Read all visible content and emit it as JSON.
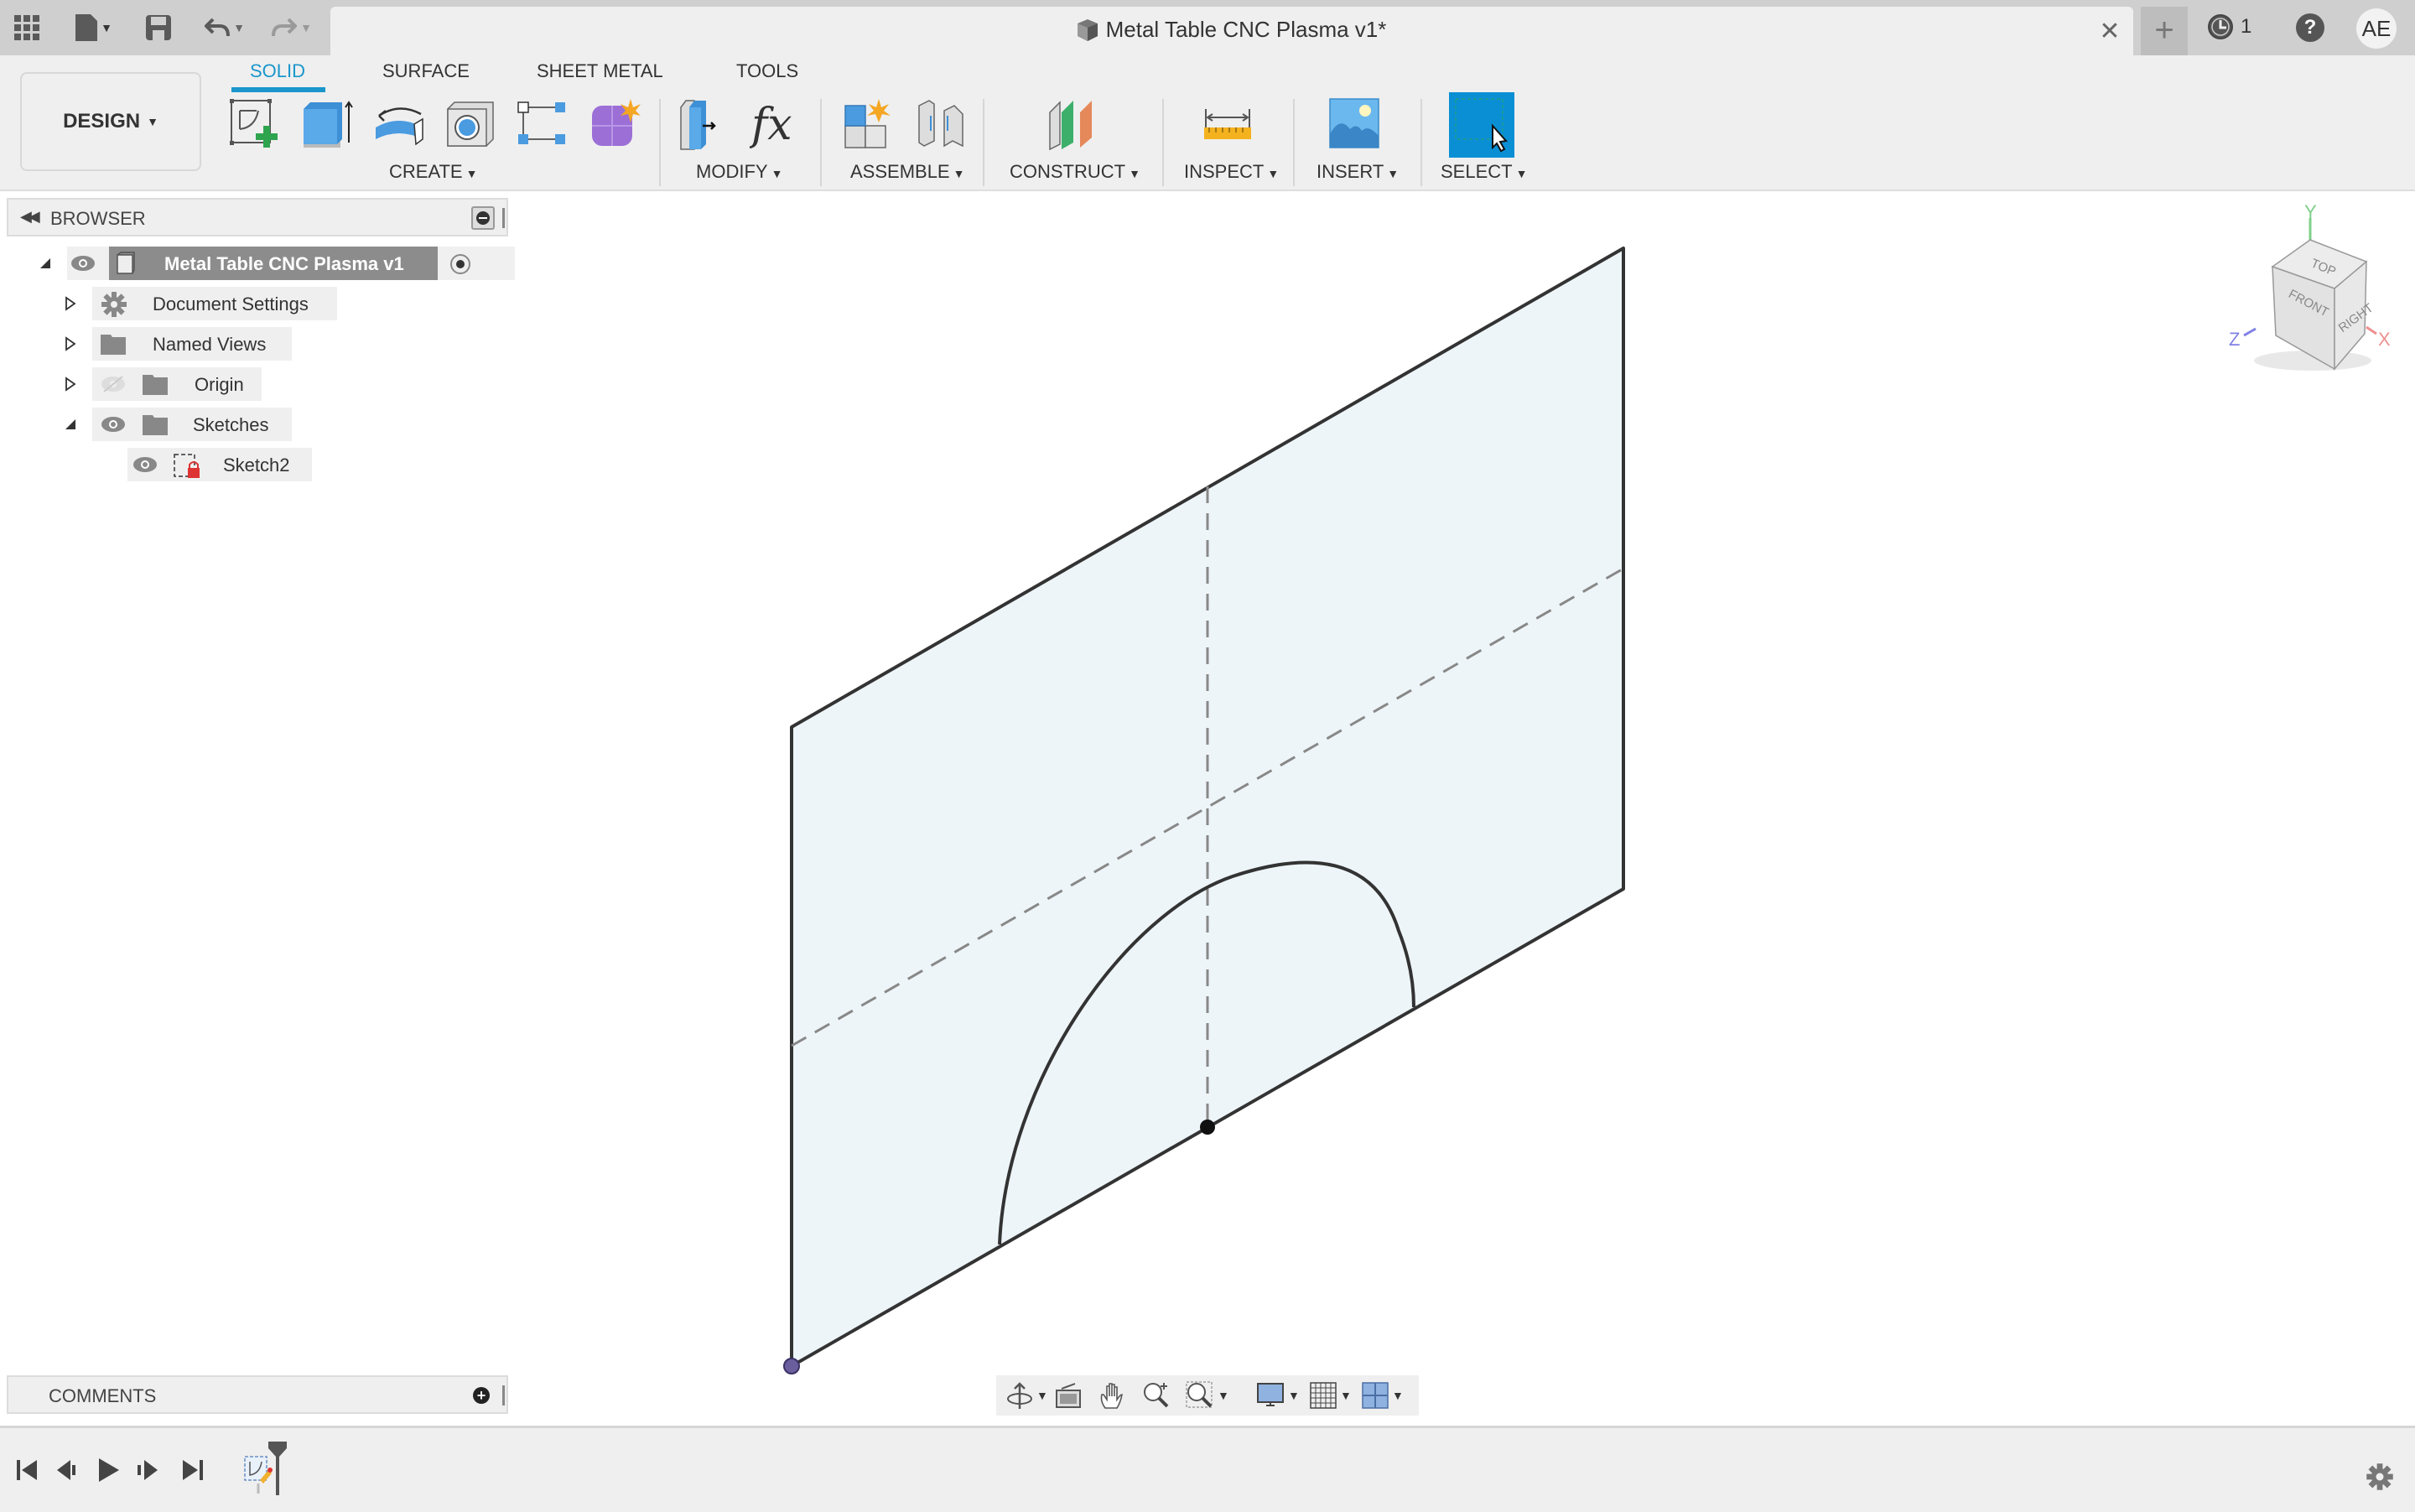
{
  "app": {
    "document_title": "Metal Table CNC Plasma v1*",
    "jobs_count": "1",
    "user_initials": "AE"
  },
  "topbar": {
    "icons": [
      "apps-grid-icon",
      "file-icon",
      "save-icon",
      "undo-icon",
      "redo-icon"
    ]
  },
  "workspace": {
    "label": "DESIGN"
  },
  "ribbon": {
    "tabs": [
      {
        "label": "SOLID",
        "active": true
      },
      {
        "label": "SURFACE",
        "active": false
      },
      {
        "label": "SHEET METAL",
        "active": false
      },
      {
        "label": "TOOLS",
        "active": false
      }
    ],
    "groups": [
      {
        "label": "CREATE",
        "tools": [
          "create-sketch",
          "extrude",
          "revolve",
          "hole",
          "pattern",
          "create-form"
        ]
      },
      {
        "label": "MODIFY",
        "tools": [
          "press-pull",
          "parameters"
        ]
      },
      {
        "label": "ASSEMBLE",
        "tools": [
          "new-component",
          "joint"
        ]
      },
      {
        "label": "CONSTRUCT",
        "tools": [
          "offset-plane"
        ]
      },
      {
        "label": "INSPECT",
        "tools": [
          "measure"
        ]
      },
      {
        "label": "INSERT",
        "tools": [
          "insert-image"
        ]
      },
      {
        "label": "SELECT",
        "tools": [
          "select"
        ]
      }
    ],
    "accent_color": "#1a96cc"
  },
  "browser": {
    "title": "BROWSER",
    "items": [
      {
        "label": "Metal Table CNC Plasma v1",
        "expanded": true,
        "visible": true,
        "selected": true
      },
      {
        "label": "Document Settings",
        "expanded": false
      },
      {
        "label": "Named Views",
        "expanded": false
      },
      {
        "label": "Origin",
        "expanded": false,
        "visible": false
      },
      {
        "label": "Sketches",
        "expanded": true,
        "visible": true
      },
      {
        "label": "Sketch2",
        "visible": true
      }
    ]
  },
  "comments": {
    "title": "COMMENTS"
  },
  "viewcube": {
    "faces": {
      "top": "TOP",
      "front": "FRONT",
      "right": "RIGHT"
    },
    "axes": {
      "x": "X",
      "y": "Y",
      "z": "Z"
    }
  },
  "navbar": {
    "icons": [
      "orbit-icon",
      "look-at-icon",
      "pan-icon",
      "zoom-icon",
      "fit-icon",
      "display-settings-icon",
      "grid-icon",
      "viewports-icon"
    ]
  },
  "timeline": {
    "controls": [
      "go-to-start",
      "step-back",
      "play",
      "step-forward",
      "go-to-end"
    ],
    "features": [
      "sketch"
    ]
  }
}
